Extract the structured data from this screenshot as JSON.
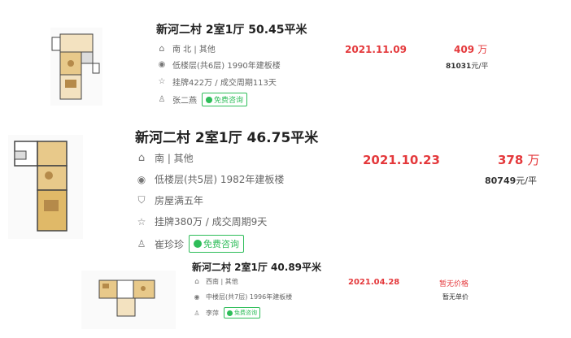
{
  "listings": [
    {
      "title": "新河二村 2室1厅 50.45平米",
      "orientation": "南 北 | 其他",
      "floor": "低楼层(共6层) 1990年建板楼",
      "tag": "",
      "listing_info": "挂牌422万 / 成交周期113天",
      "agent": "张二燕",
      "consult_label": "免费咨询",
      "deal_date": "2021.11.09",
      "total_price": "409",
      "price_unit": "万",
      "unit_price": "81031",
      "unit_price_suffix": "元/平"
    },
    {
      "title": "新河二村 2室1厅 46.75平米",
      "orientation": "南 | 其他",
      "floor": "低楼层(共5层) 1982年建板楼",
      "tag": "房屋满五年",
      "listing_info": "挂牌380万 / 成交周期9天",
      "agent": "崔珍珍",
      "consult_label": "免费咨询",
      "deal_date": "2021.10.23",
      "total_price": "378",
      "price_unit": "万",
      "unit_price": "80749",
      "unit_price_suffix": "元/平"
    },
    {
      "title": "新河二村 2室1厅 40.89平米",
      "orientation": "西南 | 其他",
      "floor": "中楼层(共7层) 1996年建板楼",
      "tag": "",
      "listing_info": "",
      "agent": "李萍",
      "consult_label": "免费咨询",
      "deal_date": "2021.04.28",
      "total_price": "暂无价格",
      "price_unit": "",
      "unit_price": "暂无单价",
      "unit_price_suffix": ""
    }
  ],
  "icons": {
    "orientation": "house-icon",
    "floor": "location-pin-icon",
    "tag": "shield-icon",
    "listing_info": "star-icon",
    "agent": "person-icon",
    "consult": "chat-bubble-icon"
  },
  "colors": {
    "price_red": "#e4393c",
    "consult_green": "#2ebd59"
  }
}
